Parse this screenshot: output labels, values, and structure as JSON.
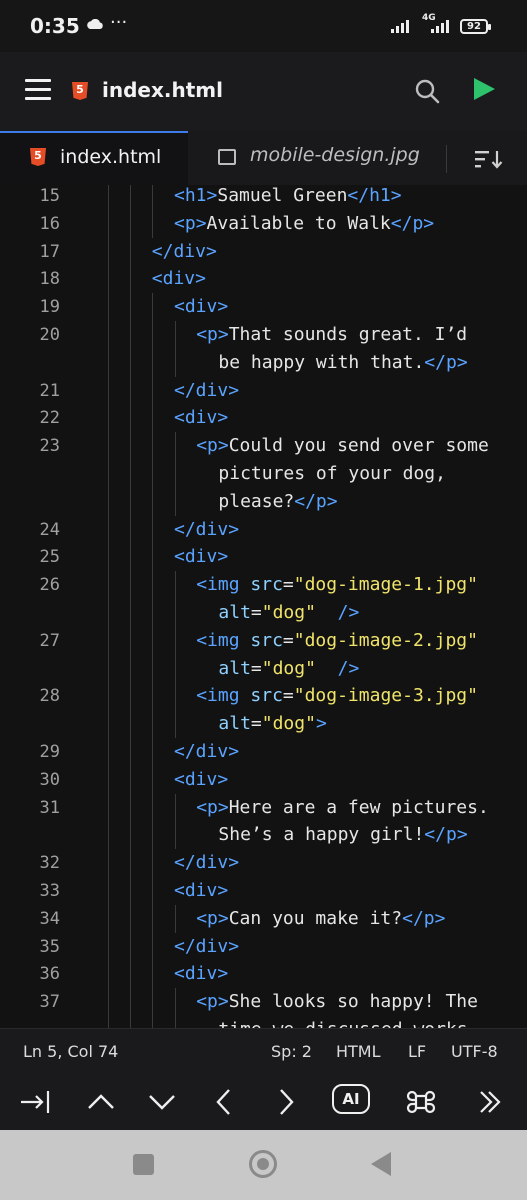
{
  "status_bar": {
    "time": "0:35",
    "dots": "···",
    "network": "4G",
    "battery": "92"
  },
  "app_bar": {
    "title": "index.html"
  },
  "tabs": [
    {
      "label": "index.html",
      "active": true
    },
    {
      "label": "mobile-design.jpg",
      "active": false
    }
  ],
  "editor": {
    "line_numbers": [
      "15",
      "16",
      "17",
      "18",
      "19",
      "20",
      "21",
      "22",
      "23",
      "24",
      "25",
      "26",
      "27",
      "28",
      "29",
      "30",
      "31",
      "32",
      "33",
      "34",
      "35",
      "36",
      "37"
    ],
    "lines": [
      {
        "indent": 6,
        "tokens": [
          [
            "tg",
            "<h1"
          ],
          [
            "tg",
            ">"
          ],
          [
            "tx",
            "Samuel Green"
          ],
          [
            "tg",
            "</h1"
          ],
          [
            "tg",
            ">"
          ]
        ]
      },
      {
        "indent": 6,
        "tokens": [
          [
            "tg",
            "<p"
          ],
          [
            "tg",
            ">"
          ],
          [
            "tx",
            "Available to Walk"
          ],
          [
            "tg",
            "</p"
          ],
          [
            "tg",
            ">"
          ]
        ]
      },
      {
        "indent": 4,
        "tokens": [
          [
            "tg",
            "</div"
          ],
          [
            "tg",
            ">"
          ]
        ]
      },
      {
        "indent": 4,
        "tokens": [
          [
            "tg",
            "<div"
          ],
          [
            "tg",
            ">"
          ]
        ]
      },
      {
        "indent": 6,
        "tokens": [
          [
            "tg",
            "<div"
          ],
          [
            "tg",
            ">"
          ]
        ]
      },
      {
        "indent": 8,
        "tokens": [
          [
            "tg",
            "<p"
          ],
          [
            "tg",
            ">"
          ],
          [
            "tx",
            "That sounds great. I’d"
          ]
        ],
        "wrap": [
          [
            "tx",
            "be happy with that."
          ],
          [
            "tg",
            "</p"
          ],
          [
            "tg",
            ">"
          ]
        ]
      },
      {
        "indent": 6,
        "tokens": [
          [
            "tg",
            "</div"
          ],
          [
            "tg",
            ">"
          ]
        ]
      },
      {
        "indent": 6,
        "tokens": [
          [
            "tg",
            "<div"
          ],
          [
            "tg",
            ">"
          ]
        ]
      },
      {
        "indent": 8,
        "tokens": [
          [
            "tg",
            "<p"
          ],
          [
            "tg",
            ">"
          ],
          [
            "tx",
            "Could you send over some"
          ]
        ],
        "wrap": [
          [
            "tx",
            "pictures of your dog,"
          ]
        ],
        "wrap2": [
          [
            "tx",
            "please?"
          ],
          [
            "tg",
            "</p"
          ],
          [
            "tg",
            ">"
          ]
        ]
      },
      {
        "indent": 6,
        "tokens": [
          [
            "tg",
            "</div"
          ],
          [
            "tg",
            ">"
          ]
        ]
      },
      {
        "indent": 6,
        "tokens": [
          [
            "tg",
            "<div"
          ],
          [
            "tg",
            ">"
          ]
        ]
      },
      {
        "indent": 8,
        "tokens": [
          [
            "tg",
            "<img"
          ],
          [
            "tx",
            " "
          ],
          [
            "at",
            "src"
          ],
          [
            "tx",
            "="
          ],
          [
            "st",
            "\"dog-image-1.jpg\""
          ]
        ],
        "wrap": [
          [
            "at",
            "alt"
          ],
          [
            "tx",
            "="
          ],
          [
            "st",
            "\"dog\""
          ],
          [
            "tx",
            "  "
          ],
          [
            "tg",
            "/>"
          ]
        ]
      },
      {
        "indent": 8,
        "tokens": [
          [
            "tg",
            "<img"
          ],
          [
            "tx",
            " "
          ],
          [
            "at",
            "src"
          ],
          [
            "tx",
            "="
          ],
          [
            "st",
            "\"dog-image-2.jpg\""
          ]
        ],
        "wrap": [
          [
            "at",
            "alt"
          ],
          [
            "tx",
            "="
          ],
          [
            "st",
            "\"dog\""
          ],
          [
            "tx",
            "  "
          ],
          [
            "tg",
            "/>"
          ]
        ]
      },
      {
        "indent": 8,
        "tokens": [
          [
            "tg",
            "<img"
          ],
          [
            "tx",
            " "
          ],
          [
            "at",
            "src"
          ],
          [
            "tx",
            "="
          ],
          [
            "st",
            "\"dog-image-3.jpg\""
          ]
        ],
        "wrap": [
          [
            "at",
            "alt"
          ],
          [
            "tx",
            "="
          ],
          [
            "st",
            "\"dog\""
          ],
          [
            "tg",
            ">"
          ]
        ]
      },
      {
        "indent": 6,
        "tokens": [
          [
            "tg",
            "</div"
          ],
          [
            "tg",
            ">"
          ]
        ]
      },
      {
        "indent": 6,
        "tokens": [
          [
            "tg",
            "<div"
          ],
          [
            "tg",
            ">"
          ]
        ]
      },
      {
        "indent": 8,
        "tokens": [
          [
            "tg",
            "<p"
          ],
          [
            "tg",
            ">"
          ],
          [
            "tx",
            "Here are a few pictures."
          ]
        ],
        "wrap": [
          [
            "tx",
            "She’s a happy girl!"
          ],
          [
            "tg",
            "</p"
          ],
          [
            "tg",
            ">"
          ]
        ]
      },
      {
        "indent": 6,
        "tokens": [
          [
            "tg",
            "</div"
          ],
          [
            "tg",
            ">"
          ]
        ]
      },
      {
        "indent": 6,
        "tokens": [
          [
            "tg",
            "<div"
          ],
          [
            "tg",
            ">"
          ]
        ]
      },
      {
        "indent": 8,
        "tokens": [
          [
            "tg",
            "<p"
          ],
          [
            "tg",
            ">"
          ],
          [
            "tx",
            "Can you make it?"
          ],
          [
            "tg",
            "</p"
          ],
          [
            "tg",
            ">"
          ]
        ]
      },
      {
        "indent": 6,
        "tokens": [
          [
            "tg",
            "</div"
          ],
          [
            "tg",
            ">"
          ]
        ]
      },
      {
        "indent": 6,
        "tokens": [
          [
            "tg",
            "<div"
          ],
          [
            "tg",
            ">"
          ]
        ]
      },
      {
        "indent": 8,
        "tokens": [
          [
            "tg",
            "<p"
          ],
          [
            "tg",
            ">"
          ],
          [
            "tx",
            "She looks so happy! The"
          ]
        ],
        "wrap": [
          [
            "tx",
            "time we discussed works"
          ]
        ]
      }
    ]
  },
  "status_line": {
    "position": "Ln 5, Col 74",
    "spaces": "Sp: 2",
    "language": "HTML",
    "line_ending": "LF",
    "encoding": "UTF-8"
  },
  "toolbar": {
    "ai_label": "AI"
  },
  "colors": {
    "tag": "#5aa3ff",
    "attribute": "#8fd0ff",
    "string": "#f0e46a",
    "run": "#2dc26b",
    "html5": "#e44d26",
    "active_tab": "#3d7be8"
  }
}
